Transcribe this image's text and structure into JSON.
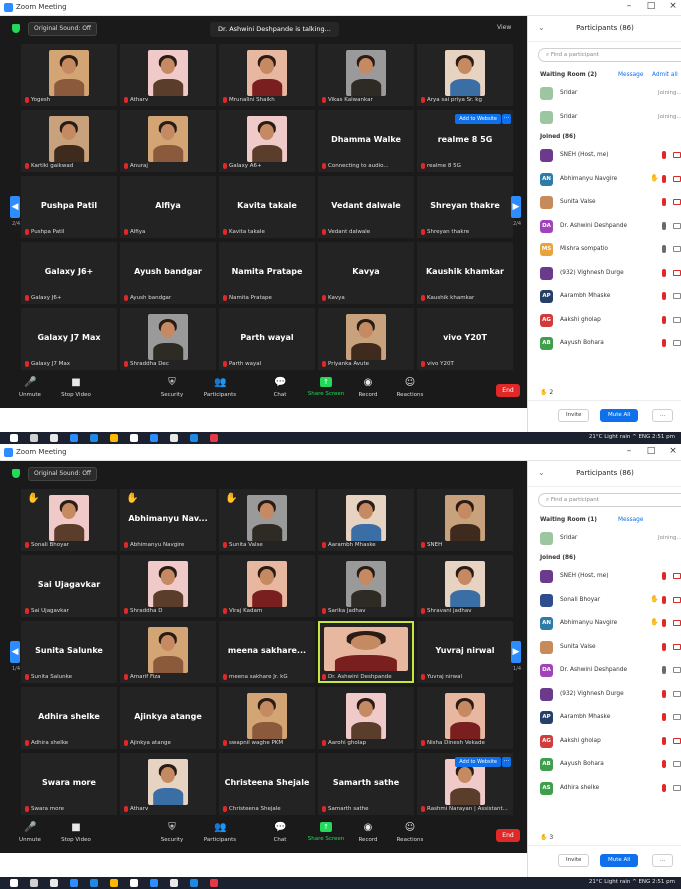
{
  "screenshots": [
    {
      "window_title": "Zoom Meeting",
      "sound_button": "Original Sound: Off",
      "talking_indicator": "Dr. Ashwini Deshpande is talking...",
      "view_label": "View",
      "page_left": "2/4",
      "page_right": "2/4",
      "tiles": [
        {
          "name": "Yogesh",
          "big": "",
          "photo": true,
          "hand": false
        },
        {
          "name": "Atharv",
          "big": "",
          "photo": true,
          "hand": false
        },
        {
          "name": "Mrunalini Shaikh",
          "big": "",
          "photo": true,
          "hand": false
        },
        {
          "name": "Vikas Kalwankar",
          "big": "",
          "photo": true,
          "hand": false
        },
        {
          "name": "Arya sai priya Sr. kg",
          "big": "",
          "photo": true,
          "hand": false
        },
        {
          "name": "Kartiki gaikwad",
          "big": "",
          "photo": true,
          "hand": false
        },
        {
          "name": "Anuraj",
          "big": "",
          "photo": true,
          "hand": false
        },
        {
          "name": "Galaxy A6+",
          "big": "",
          "photo": true,
          "hand": false
        },
        {
          "name": "Connecting to audio...",
          "big": "Dhamma Walke",
          "photo": false,
          "hand": false
        },
        {
          "name": "realme 8 5G",
          "big": "realme 8 5G",
          "photo": false,
          "hand": false,
          "add": "Add to Website"
        },
        {
          "name": "Pushpa Patil",
          "big": "Pushpa Patil",
          "photo": false,
          "hand": false
        },
        {
          "name": "Alfiya",
          "big": "Alfiya",
          "photo": false,
          "hand": false
        },
        {
          "name": "Kavita takale",
          "big": "Kavita takale",
          "photo": false,
          "hand": false
        },
        {
          "name": "Vedant dalwale",
          "big": "Vedant dalwale",
          "photo": false,
          "hand": false
        },
        {
          "name": "Shreyan thakre",
          "big": "Shreyan thakre",
          "photo": false,
          "hand": false
        },
        {
          "name": "Galaxy J6+",
          "big": "Galaxy J6+",
          "photo": false,
          "hand": false
        },
        {
          "name": "Ayush bandgar",
          "big": "Ayush bandgar",
          "photo": false,
          "hand": false
        },
        {
          "name": "Namita Pratape",
          "big": "Namita Pratape",
          "photo": false,
          "hand": false
        },
        {
          "name": "Kavya",
          "big": "Kavya",
          "photo": false,
          "hand": false
        },
        {
          "name": "Kaushik khamkar",
          "big": "Kaushik khamkar",
          "photo": false,
          "hand": false
        },
        {
          "name": "Galaxy J7 Max",
          "big": "Galaxy J7 Max",
          "photo": false,
          "hand": false
        },
        {
          "name": "Shraddha Dec",
          "big": "",
          "photo": true,
          "hand": false
        },
        {
          "name": "Parth wayal",
          "big": "Parth wayal",
          "photo": false,
          "hand": false
        },
        {
          "name": "Priyanka Avute",
          "big": "",
          "photo": true,
          "hand": false
        },
        {
          "name": "vivo Y20T",
          "big": "vivo Y20T",
          "photo": false,
          "hand": false
        }
      ],
      "toolbar": [
        {
          "label": "Unmute",
          "icon": "🎤",
          "red": true
        },
        {
          "label": "Stop Video",
          "icon": "■",
          "red": false
        },
        {
          "label": "Security",
          "icon": "⛨",
          "red": false
        },
        {
          "label": "Participants",
          "icon": "👥",
          "red": false,
          "count": "88"
        },
        {
          "label": "Chat",
          "icon": "💬",
          "red": false
        },
        {
          "label": "Share Screen",
          "icon": "↑",
          "red": false,
          "green": true
        },
        {
          "label": "Record",
          "icon": "◉",
          "red": false
        },
        {
          "label": "Reactions",
          "icon": "☺",
          "red": false
        }
      ],
      "end_label": "End",
      "tray_text": "21°C Light rain  ^  ENG  2:51 pm",
      "panel": {
        "title": "Participants (86)",
        "search_placeholder": "Find a participant",
        "waiting_label": "Waiting Room (2)",
        "message_link": "Message",
        "admit_all_link": "Admit all",
        "joined_label": "Joined (86)",
        "hand_count": "2",
        "invite_label": "Invite",
        "mute_all_label": "Mute All",
        "more_label": "...",
        "waiting": [
          {
            "initials": "",
            "name": "Sridar",
            "status": "Joining...",
            "color": "#9cc6a0"
          },
          {
            "initials": "",
            "name": "Sridar",
            "status": "Joining...",
            "color": "#9cc6a0"
          }
        ],
        "joined": [
          {
            "initials": "",
            "name": "SNEH (Host, me)",
            "color": "#6b3a8c",
            "hand": false,
            "mic": "off",
            "cam": "off"
          },
          {
            "initials": "AN",
            "name": "Abhimanyu Navgire",
            "color": "#2e7ba8",
            "hand": true,
            "mic": "off",
            "cam": "off"
          },
          {
            "initials": "",
            "name": "Sunita Valse",
            "color": "#c78a5a",
            "hand": false,
            "mic": "off",
            "cam": "off"
          },
          {
            "initials": "DA",
            "name": "Dr. Ashwini Deshpande",
            "color": "#a042b8",
            "hand": false,
            "mic": "on",
            "cam": "on"
          },
          {
            "initials": "MS",
            "name": "Mishra sompatio",
            "color": "#e8a33a",
            "hand": false,
            "mic": "on",
            "cam": "on"
          },
          {
            "initials": "",
            "name": "(932) Vighnesh Durge",
            "color": "#6b3a8c",
            "hand": false,
            "mic": "off",
            "cam": "off"
          },
          {
            "initials": "AP",
            "name": "Aarambh Mhaske",
            "color": "#263f66",
            "hand": false,
            "mic": "off",
            "cam": "on"
          },
          {
            "initials": "AG",
            "name": "Aakshi gholap",
            "color": "#d23b3b",
            "hand": false,
            "mic": "off",
            "cam": "on"
          },
          {
            "initials": "AB",
            "name": "Aayush Bohara",
            "color": "#3e9e4c",
            "hand": false,
            "mic": "off",
            "cam": "on"
          }
        ]
      }
    },
    {
      "window_title": "Zoom Meeting",
      "sound_button": "Original Sound: Off",
      "talking_indicator": "",
      "view_label": "",
      "page_left": "1/4",
      "page_right": "1/4",
      "tiles": [
        {
          "name": "Sonali Bhoyar",
          "big": "",
          "photo": true,
          "hand": true
        },
        {
          "name": "Abhimanyu Navgire",
          "big": "Abhimanyu Nav...",
          "photo": false,
          "hand": true
        },
        {
          "name": "Sunita Valse",
          "big": "",
          "photo": true,
          "hand": true
        },
        {
          "name": "Aarambh Mhaske",
          "big": "",
          "photo": true,
          "hand": false
        },
        {
          "name": "SNEH",
          "big": "",
          "photo": true,
          "hand": false
        },
        {
          "name": "Sai Ujagavkar",
          "big": "Sai Ujagavkar",
          "photo": false,
          "hand": false
        },
        {
          "name": "Shraddha D",
          "big": "",
          "photo": true,
          "hand": false
        },
        {
          "name": "Viraj Kadam",
          "big": "",
          "photo": true,
          "hand": false
        },
        {
          "name": "Sarika Jadhav",
          "big": "",
          "photo": true,
          "hand": false
        },
        {
          "name": "Shravani jadhav",
          "big": "",
          "photo": true,
          "hand": false
        },
        {
          "name": "Sunita Salunke",
          "big": "Sunita Salunke",
          "photo": false,
          "hand": false
        },
        {
          "name": "Amarif Fiza",
          "big": "",
          "photo": true,
          "hand": false
        },
        {
          "name": "meena sakhare Jr. kG",
          "big": "meena sakhare...",
          "photo": false,
          "hand": false
        },
        {
          "name": "Dr. Ashwini Deshpande",
          "big": "",
          "photo": true,
          "hand": false,
          "speaking": true
        },
        {
          "name": "Yuvraj nirwal",
          "big": "Yuvraj nirwal",
          "photo": false,
          "hand": false
        },
        {
          "name": "Adhira shelke",
          "big": "Adhira shelke",
          "photo": false,
          "hand": false
        },
        {
          "name": "Ajinkya atange",
          "big": "Ajinkya atange",
          "photo": false,
          "hand": false
        },
        {
          "name": "swapnil waghe PKM",
          "big": "",
          "photo": true,
          "hand": false
        },
        {
          "name": "Aarohi gholap",
          "big": "",
          "photo": true,
          "hand": false
        },
        {
          "name": "Nisha Dinesh Vekade",
          "big": "",
          "photo": true,
          "hand": false
        },
        {
          "name": "Swara more",
          "big": "Swara more",
          "photo": false,
          "hand": false
        },
        {
          "name": "Atharv",
          "big": "",
          "photo": true,
          "hand": false
        },
        {
          "name": "Christeena Shejale",
          "big": "Christeena Shejale",
          "photo": false,
          "hand": false
        },
        {
          "name": "Samarth sathe",
          "big": "Samarth sathe",
          "photo": false,
          "hand": false
        },
        {
          "name": "Rashmi Narayan | Assistant...",
          "big": "",
          "photo": true,
          "hand": false,
          "add": "Add to Website"
        }
      ],
      "toolbar": [
        {
          "label": "Unmute",
          "icon": "🎤",
          "red": true
        },
        {
          "label": "Stop Video",
          "icon": "■",
          "red": false
        },
        {
          "label": "Security",
          "icon": "⛨",
          "red": false
        },
        {
          "label": "Participants",
          "icon": "👥",
          "red": false,
          "count": "87"
        },
        {
          "label": "Chat",
          "icon": "💬",
          "red": false
        },
        {
          "label": "Share Screen",
          "icon": "↑",
          "red": false,
          "green": true
        },
        {
          "label": "Record",
          "icon": "◉",
          "red": false
        },
        {
          "label": "Reactions",
          "icon": "☺",
          "red": false
        }
      ],
      "end_label": "End",
      "tray_text": "21°C Light rain  ^  ENG  2:51 pm",
      "panel": {
        "title": "Participants (86)",
        "search_placeholder": "Find a participant",
        "waiting_label": "Waiting Room (1)",
        "message_link": "Message",
        "admit_all_link": "",
        "joined_label": "Joined (86)",
        "hand_count": "3",
        "invite_label": "Invite",
        "mute_all_label": "Mute All",
        "more_label": "...",
        "waiting": [
          {
            "initials": "",
            "name": "Sridar",
            "status": "Joining...",
            "color": "#9cc6a0"
          }
        ],
        "joined": [
          {
            "initials": "",
            "name": "SNEH (Host, me)",
            "color": "#6b3a8c",
            "hand": false,
            "mic": "off",
            "cam": "off"
          },
          {
            "initials": "",
            "name": "Sonali Bhoyar",
            "color": "#2f4d8c",
            "hand": true,
            "mic": "off",
            "cam": "off"
          },
          {
            "initials": "AN",
            "name": "Abhimanyu Navgire",
            "color": "#2e7ba8",
            "hand": true,
            "mic": "off",
            "cam": "off"
          },
          {
            "initials": "",
            "name": "Sunita Valse",
            "color": "#c78a5a",
            "hand": false,
            "mic": "off",
            "cam": "off"
          },
          {
            "initials": "DA",
            "name": "Dr. Ashwini Deshpande",
            "color": "#a042b8",
            "hand": false,
            "mic": "on",
            "cam": "on"
          },
          {
            "initials": "",
            "name": "(932) Vighnesh Durge",
            "color": "#6b3a8c",
            "hand": false,
            "mic": "off",
            "cam": "on"
          },
          {
            "initials": "AP",
            "name": "Aarambh Mhaske",
            "color": "#263f66",
            "hand": false,
            "mic": "off",
            "cam": "on"
          },
          {
            "initials": "AG",
            "name": "Aakshi gholap",
            "color": "#d23b3b",
            "hand": false,
            "mic": "off",
            "cam": "off"
          },
          {
            "initials": "AB",
            "name": "Aayush Bohara",
            "color": "#3e9e4c",
            "hand": false,
            "mic": "off",
            "cam": "on"
          },
          {
            "initials": "AS",
            "name": "Adhira shelke",
            "color": "#3e9e4c",
            "hand": false,
            "mic": "off",
            "cam": "on"
          }
        ]
      }
    }
  ]
}
